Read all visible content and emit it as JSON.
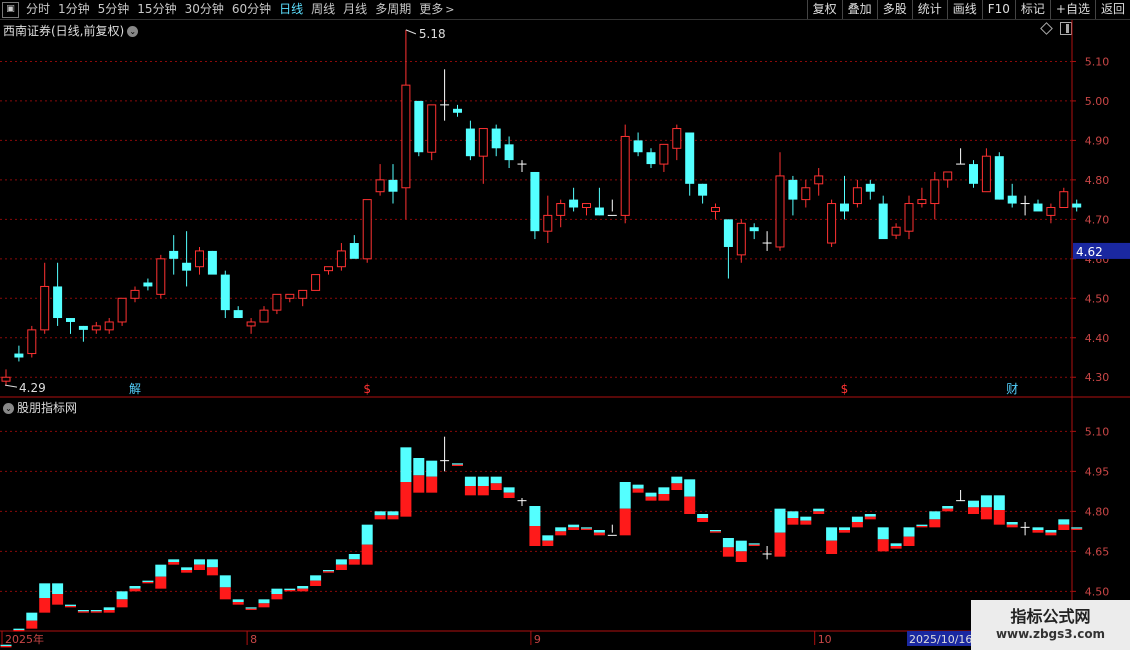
{
  "toolbar": {
    "menu_icon": "menu-icon",
    "periods": [
      "分时",
      "1分钟",
      "5分钟",
      "15分钟",
      "30分钟",
      "60分钟",
      "日线",
      "周线",
      "月线",
      "多周期",
      "更多"
    ],
    "active_period": "日线",
    "more_chevron": ">",
    "actions": [
      "复权",
      "叠加",
      "多股",
      "统计",
      "画线",
      "F10",
      "标记",
      "+自选",
      "返回"
    ]
  },
  "panel_top": {
    "title": "西南证券(日线,前复权)",
    "icons": [
      "diamond-icon",
      "layout-icon"
    ]
  },
  "panel_bottom": {
    "title": "股朋指标网"
  },
  "watermark": {
    "title": "指标公式网",
    "url": "www.zbgs3.com"
  },
  "colors": {
    "up": "#ff3232",
    "up_fill": "#ff1a1a",
    "down": "#54ffff",
    "doji": "#ffffff",
    "grid": "#8a0a0a",
    "price_label_bg": "#1a28a0",
    "date_highlight_bg": "#1a28a0",
    "axis_text": "#c84646"
  },
  "chart_data": {
    "type": "candlestick",
    "y_ticks": [
      4.3,
      4.4,
      4.5,
      4.6,
      4.7,
      4.8,
      4.9,
      5.0,
      5.1
    ],
    "y_range": [
      4.255,
      5.205
    ],
    "current_price": "4.62",
    "high_marker": "5.18",
    "low_marker": "4.29",
    "sub_y_ticks": [
      4.5,
      4.65,
      4.8,
      4.95,
      5.1
    ],
    "sub_y_range": [
      4.355,
      5.225
    ],
    "x_labels": [
      {
        "i": 0,
        "label": "2025年"
      },
      {
        "i": 19,
        "label": "8"
      },
      {
        "i": 41,
        "label": "9"
      },
      {
        "i": 63,
        "label": "10"
      },
      {
        "i": 70,
        "label": "2025/10/16/四",
        "highlight": true
      }
    ],
    "event_markers": [
      {
        "i": 10,
        "label": "解",
        "color": "#54d2ff"
      },
      {
        "i": 28,
        "label": "$",
        "color": "#ff3232"
      },
      {
        "i": 65,
        "label": "$",
        "color": "#ff3232"
      },
      {
        "i": 78,
        "label": "财",
        "color": "#54d2ff"
      }
    ],
    "candles": [
      [
        4.29,
        4.32,
        4.28,
        4.3
      ],
      [
        4.36,
        4.38,
        4.34,
        4.35
      ],
      [
        4.36,
        4.43,
        4.35,
        4.42
      ],
      [
        4.42,
        4.59,
        4.41,
        4.53
      ],
      [
        4.53,
        4.59,
        4.43,
        4.45
      ],
      [
        4.45,
        4.45,
        4.41,
        4.44
      ],
      [
        4.43,
        4.43,
        4.39,
        4.42
      ],
      [
        4.42,
        4.44,
        4.41,
        4.43
      ],
      [
        4.42,
        4.45,
        4.41,
        4.44
      ],
      [
        4.44,
        4.5,
        4.43,
        4.5
      ],
      [
        4.5,
        4.53,
        4.49,
        4.52
      ],
      [
        4.54,
        4.55,
        4.52,
        4.53
      ],
      [
        4.51,
        4.61,
        4.5,
        4.6
      ],
      [
        4.62,
        4.66,
        4.56,
        4.6
      ],
      [
        4.59,
        4.67,
        4.53,
        4.57
      ],
      [
        4.58,
        4.63,
        4.56,
        4.62
      ],
      [
        4.62,
        4.62,
        4.57,
        4.56
      ],
      [
        4.56,
        4.57,
        4.45,
        4.47
      ],
      [
        4.47,
        4.48,
        4.45,
        4.45
      ],
      [
        4.43,
        4.45,
        4.41,
        4.44
      ],
      [
        4.44,
        4.48,
        4.44,
        4.47
      ],
      [
        4.47,
        4.51,
        4.46,
        4.51
      ],
      [
        4.5,
        4.51,
        4.49,
        4.51
      ],
      [
        4.5,
        4.52,
        4.48,
        4.52
      ],
      [
        4.52,
        4.56,
        4.52,
        4.56
      ],
      [
        4.57,
        4.58,
        4.56,
        4.58
      ],
      [
        4.58,
        4.64,
        4.57,
        4.62
      ],
      [
        4.64,
        4.66,
        4.61,
        4.6
      ],
      [
        4.6,
        4.73,
        4.59,
        4.75
      ],
      [
        4.77,
        4.84,
        4.76,
        4.8
      ],
      [
        4.8,
        4.84,
        4.74,
        4.77
      ],
      [
        4.78,
        5.18,
        4.7,
        5.04
      ],
      [
        5.0,
        5.0,
        4.86,
        4.87
      ],
      [
        4.87,
        4.99,
        4.85,
        4.99
      ],
      [
        4.99,
        5.08,
        4.95,
        4.99
      ],
      [
        4.98,
        4.99,
        4.96,
        4.97
      ],
      [
        4.93,
        4.95,
        4.85,
        4.86
      ],
      [
        4.86,
        4.92,
        4.79,
        4.93
      ],
      [
        4.93,
        4.94,
        4.86,
        4.88
      ],
      [
        4.89,
        4.91,
        4.83,
        4.85
      ],
      [
        4.84,
        4.85,
        4.82,
        4.84
      ],
      [
        4.82,
        4.82,
        4.65,
        4.67
      ],
      [
        4.67,
        4.76,
        4.64,
        4.71
      ],
      [
        4.71,
        4.75,
        4.68,
        4.74
      ],
      [
        4.75,
        4.78,
        4.72,
        4.73
      ],
      [
        4.73,
        4.74,
        4.71,
        4.74
      ],
      [
        4.73,
        4.78,
        4.71,
        4.71
      ],
      [
        4.71,
        4.75,
        4.72,
        4.71
      ],
      [
        4.71,
        4.94,
        4.69,
        4.91
      ],
      [
        4.9,
        4.92,
        4.86,
        4.87
      ],
      [
        4.87,
        4.88,
        4.83,
        4.84
      ],
      [
        4.84,
        4.88,
        4.82,
        4.89
      ],
      [
        4.88,
        4.94,
        4.85,
        4.93
      ],
      [
        4.92,
        4.92,
        4.76,
        4.79
      ],
      [
        4.79,
        4.79,
        4.74,
        4.76
      ],
      [
        4.72,
        4.74,
        4.7,
        4.73
      ],
      [
        4.7,
        4.7,
        4.55,
        4.63
      ],
      [
        4.61,
        4.7,
        4.59,
        4.69
      ],
      [
        4.68,
        4.69,
        4.65,
        4.67
      ],
      [
        4.64,
        4.67,
        4.62,
        4.64
      ],
      [
        4.63,
        4.87,
        4.62,
        4.81
      ],
      [
        4.8,
        4.81,
        4.71,
        4.75
      ],
      [
        4.75,
        4.8,
        4.73,
        4.78
      ],
      [
        4.79,
        4.83,
        4.76,
        4.81
      ],
      [
        4.64,
        4.75,
        4.63,
        4.74
      ],
      [
        4.74,
        4.81,
        4.7,
        4.72
      ],
      [
        4.74,
        4.8,
        4.73,
        4.78
      ],
      [
        4.79,
        4.8,
        4.75,
        4.77
      ],
      [
        4.74,
        4.76,
        4.66,
        4.65
      ],
      [
        4.66,
        4.69,
        4.65,
        4.68
      ],
      [
        4.67,
        4.76,
        4.65,
        4.74
      ],
      [
        4.74,
        4.78,
        4.73,
        4.75
      ],
      [
        4.74,
        4.82,
        4.7,
        4.8
      ],
      [
        4.8,
        4.81,
        4.78,
        4.82
      ],
      [
        4.84,
        4.88,
        4.84,
        4.84
      ],
      [
        4.84,
        4.85,
        4.78,
        4.79
      ],
      [
        4.77,
        4.88,
        4.77,
        4.86
      ],
      [
        4.86,
        4.87,
        4.75,
        4.75
      ],
      [
        4.76,
        4.79,
        4.73,
        4.74
      ],
      [
        4.74,
        4.76,
        4.71,
        4.74
      ],
      [
        4.74,
        4.75,
        4.73,
        4.72
      ],
      [
        4.71,
        4.74,
        4.69,
        4.73
      ],
      [
        4.73,
        4.78,
        4.73,
        4.77
      ],
      [
        4.74,
        4.75,
        4.72,
        4.73
      ]
    ]
  }
}
